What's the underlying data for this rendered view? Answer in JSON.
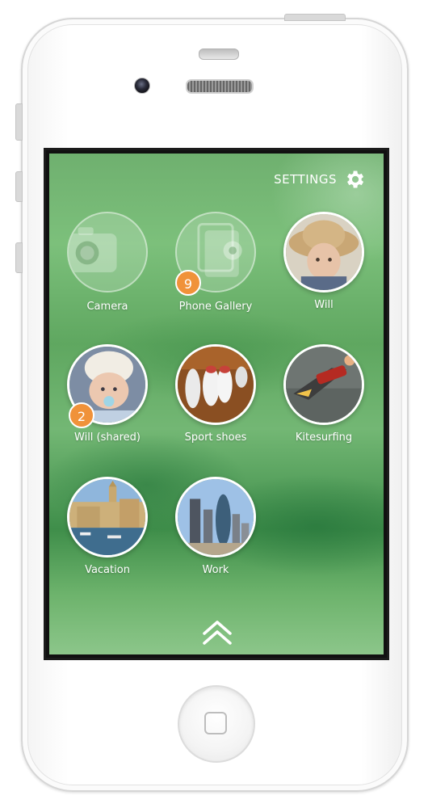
{
  "header": {
    "settings_label": "SETTINGS",
    "settings_icon": "gear-icon"
  },
  "albums": [
    {
      "label": "Camera",
      "icon": "camera-icon"
    },
    {
      "label": "Phone Gallery",
      "icon": "gallery-icon",
      "badge": "9"
    },
    {
      "label": "Will"
    },
    {
      "label": "Will (shared)",
      "badge": "2"
    },
    {
      "label": "Sport shoes"
    },
    {
      "label": "Kitesurfing"
    },
    {
      "label": "Vacation"
    },
    {
      "label": "Work"
    }
  ],
  "footer": {
    "icon": "double-chevron-up-icon"
  },
  "colors": {
    "badge": "#f0923a",
    "background": "#6fb06f",
    "text": "#ffffff"
  }
}
